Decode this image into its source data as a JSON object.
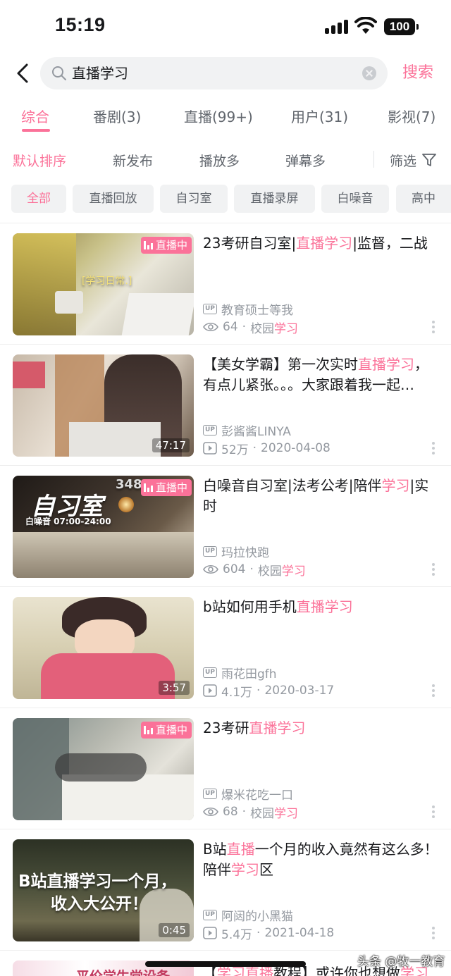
{
  "status_bar": {
    "time": "15:19",
    "battery": "100"
  },
  "search": {
    "query": "直播学习",
    "button_label": "搜索"
  },
  "tabs": [
    {
      "label": "综合",
      "active": true
    },
    {
      "label": "番剧(3)"
    },
    {
      "label": "直播(99+)"
    },
    {
      "label": "用户(31)"
    },
    {
      "label": "影视(7)"
    }
  ],
  "sort_options": [
    {
      "label": "默认排序",
      "active": true
    },
    {
      "label": "新发布"
    },
    {
      "label": "播放多"
    },
    {
      "label": "弹幕多"
    }
  ],
  "filter_label": "筛选",
  "chips": [
    {
      "label": "全部",
      "active": true
    },
    {
      "label": "直播回放"
    },
    {
      "label": "自习室"
    },
    {
      "label": "直播录屏"
    },
    {
      "label": "白噪音"
    },
    {
      "label": "高中"
    }
  ],
  "results": [
    {
      "title_parts": [
        {
          "t": "23考研自习室|"
        },
        {
          "t": "直播学习",
          "hl": true
        },
        {
          "t": "|监督，二战"
        }
      ],
      "badge": "直播中",
      "uploader": "教育硕士等我",
      "stat": "64",
      "stat_type": "viewers",
      "extra_prefix": "校园",
      "extra_hl": "学习",
      "thumb_text": "[学习日常.]"
    },
    {
      "title_parts": [
        {
          "t": "【美女学霸】第一次实时"
        },
        {
          "t": "直播学习",
          "hl": true
        },
        {
          "t": "，有点儿紧张。。。大家跟着我一起…"
        }
      ],
      "duration": "47:17",
      "uploader": "彭酱酱LINYA",
      "stat": "52万",
      "stat_type": "plays",
      "date": "2020-04-08"
    },
    {
      "title_parts": [
        {
          "t": "白噪音自习室|法考公考|陪伴"
        },
        {
          "t": "学习",
          "hl": true
        },
        {
          "t": "|实时"
        }
      ],
      "badge": "直播中",
      "uploader": "玛拉快跑",
      "stat": "604",
      "stat_type": "viewers",
      "extra_prefix": "校园",
      "extra_hl": "学习",
      "thumb_text": "自习室",
      "thumb_subtext": "白噪音 07:00-24:00",
      "thumb_number": "348"
    },
    {
      "title_parts": [
        {
          "t": "b站如何用手机"
        },
        {
          "t": "直播学习",
          "hl": true
        }
      ],
      "duration": "3:57",
      "uploader": "雨花田gfh",
      "stat": "4.1万",
      "stat_type": "plays",
      "date": "2020-03-17"
    },
    {
      "title_parts": [
        {
          "t": "23考研"
        },
        {
          "t": "直播学习",
          "hl": true
        }
      ],
      "badge": "直播中",
      "uploader": "爆米花吃一口",
      "stat": "68",
      "stat_type": "viewers",
      "extra_prefix": "校园",
      "extra_hl": "学习"
    },
    {
      "title_parts": [
        {
          "t": "B站"
        },
        {
          "t": "直播",
          "hl": true
        },
        {
          "t": "一个月的收入竟然有这么多！陪伴"
        },
        {
          "t": "学习",
          "hl": true
        },
        {
          "t": "区"
        }
      ],
      "duration": "0:45",
      "uploader": "阿闼的小黑猫",
      "stat": "5.4万",
      "stat_type": "plays",
      "date": "2021-04-18",
      "thumb_text": "B站直播学习一个月，",
      "thumb_text2": "收入大公开！"
    }
  ],
  "partial_next": {
    "title_parts": [
      {
        "t": "【"
      },
      {
        "t": "学习直播",
        "hl": true
      },
      {
        "t": "教程】或许你也想做"
      },
      {
        "t": "学习",
        "hl": true
      }
    ],
    "thumb_text": "平价学生党设备"
  },
  "up_badge_text": "UP",
  "watermark": "头条 @牧一教育",
  "colors": {
    "accent": "#fb7299",
    "text": "#18191c",
    "secondary": "#9499a0"
  }
}
